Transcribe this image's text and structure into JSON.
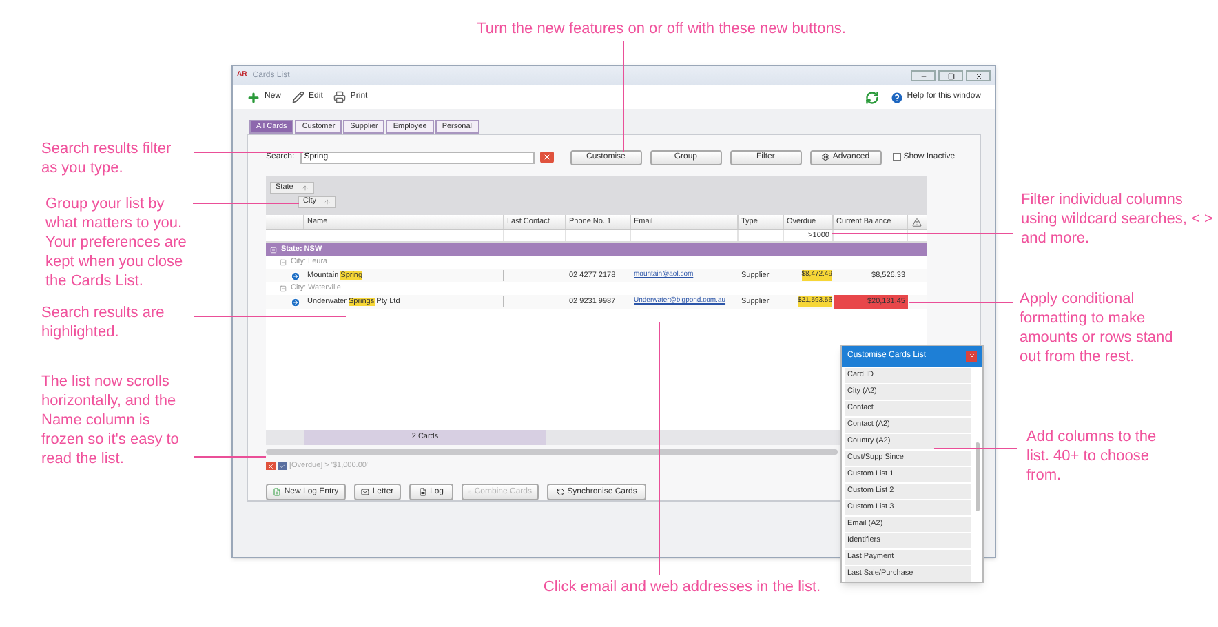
{
  "annotations": [
    {
      "kind": "top",
      "text": "Turn the new features on or off with these new buttons."
    },
    {
      "kind": "search",
      "text": "Search results filter as you type."
    },
    {
      "kind": "group",
      "text": "Group your list by what matters to you. Your preferences are kept when you close the Cards List."
    },
    {
      "kind": "highlight",
      "text": "Search results are highlighted."
    },
    {
      "kind": "scroll",
      "text": "The list now scrolls horizontally, and the Name column is frozen so it's easy to read the list."
    },
    {
      "kind": "filter",
      "text": "Filter individual columns using wildcard searches, < > and more."
    },
    {
      "kind": "format",
      "text": "Apply conditional formatting to make amounts or rows stand out from the rest."
    },
    {
      "kind": "columns",
      "text": "Add columns to the list. 40+ to choose from."
    },
    {
      "kind": "email",
      "text": "Click email and web addresses in the list."
    }
  ],
  "window": {
    "logo": "AR",
    "title": "Cards List",
    "toolbar": [
      "New",
      "Edit",
      "Print"
    ],
    "help": "Help for this window"
  },
  "tabs": [
    {
      "label": "All Cards",
      "selected": true
    },
    {
      "label": "Customer",
      "selected": false
    },
    {
      "label": "Supplier",
      "selected": false
    },
    {
      "label": "Employee",
      "selected": false
    },
    {
      "label": "Personal",
      "selected": false
    }
  ],
  "search": {
    "label": "Search:",
    "value": "Spring"
  },
  "buttons": [
    "Customise",
    "Group",
    "Filter",
    "Advanced"
  ],
  "show_inactive": {
    "label": "Show Inactive",
    "checked": false
  },
  "group_by": [
    "State",
    "City"
  ],
  "table": {
    "columns": [
      {
        "label": "Name"
      },
      {
        "label": "Last Contact"
      },
      {
        "label": "Phone No. 1"
      },
      {
        "label": "Email"
      },
      {
        "label": "Type"
      },
      {
        "label": "Overdue",
        "filter": ">1000"
      },
      {
        "label": "Current Balance"
      }
    ],
    "groups": [
      {
        "label": "State: NSW",
        "children": [
          {
            "label": "City: Leura",
            "rows": [
              {
                "name_parts": [
                  {
                    "text": "Mountain ",
                    "highlighted": false
                  },
                  {
                    "text": "Spring",
                    "highlighted": true
                  }
                ],
                "phone": "02 4277 2178",
                "email": "mountain@aol.com",
                "type": "Supplier",
                "overdue": "$8,472.49",
                "overdue_highlighted": true,
                "balance": "$8,526.33",
                "balance_flagged": false
              }
            ]
          },
          {
            "label": "City: Waterville",
            "rows": [
              {
                "name_parts": [
                  {
                    "text": "Underwater ",
                    "highlighted": false
                  },
                  {
                    "text": "Springs",
                    "highlighted": true
                  },
                  {
                    "text": " Pty Ltd",
                    "highlighted": false
                  }
                ],
                "phone": "02 9231 9987",
                "email": "Underwater@bigpond.com.au",
                "type": "Supplier",
                "overdue": "$21,593.56",
                "overdue_highlighted": true,
                "balance": "$20,131.45",
                "balance_flagged": true
              }
            ]
          }
        ]
      }
    ],
    "footer": "2 Cards"
  },
  "active_filter": {
    "text": "[Overdue] > '$1,000.00'",
    "checked": true
  },
  "bottom_buttons": [
    {
      "label": "New Log Entry",
      "disabled": false
    },
    {
      "label": "Letter",
      "disabled": false
    },
    {
      "label": "Log",
      "disabled": false
    },
    {
      "label": "Combine Cards",
      "disabled": true
    },
    {
      "label": "Synchronise Cards",
      "disabled": false
    }
  ],
  "customise_panel": {
    "title": "Customise Cards List",
    "items": [
      "Card ID",
      "City (A2)",
      "Contact",
      "Contact (A2)",
      "Country (A2)",
      "Cust/Supp Since",
      "Custom List 1",
      "Custom List 2",
      "Custom List 3",
      "Email (A2)",
      "Identifiers",
      "Last Payment",
      "Last Sale/Purchase"
    ]
  }
}
